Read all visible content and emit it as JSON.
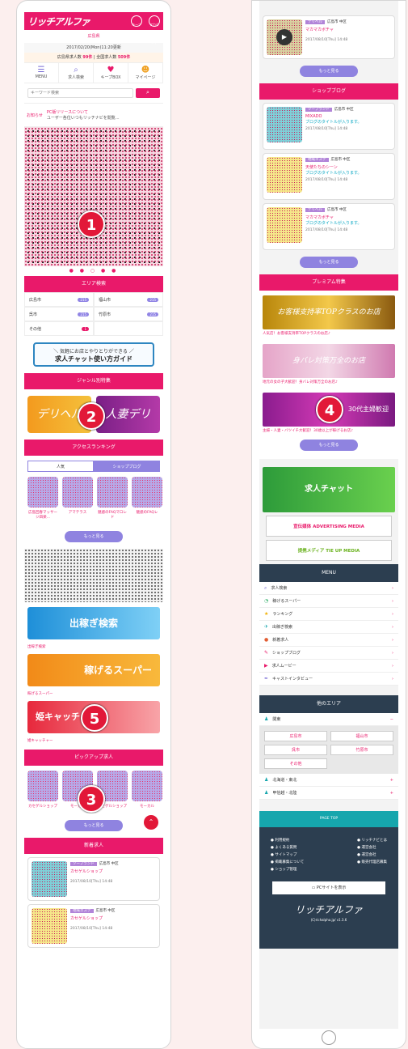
{
  "app": {
    "logo": "リッチアルファ",
    "header_icons": [
      "キープ",
      "アカウント"
    ]
  },
  "location": "広島県",
  "datetime": "2017/02/20(Mon)11:20更新",
  "counts": {
    "jobs_label": "広島県求人数",
    "jobs": "99件",
    "all_label": "全国求人数",
    "all": "509件"
  },
  "nav": [
    {
      "icon": "☰",
      "label": "MENU"
    },
    {
      "icon": "⌕",
      "label": "求人検索"
    },
    {
      "icon": "♥",
      "label": "キープBOX"
    },
    {
      "icon": "☻",
      "label": "マイページ"
    }
  ],
  "search": {
    "placeholder": "キーワード検索",
    "button": "⌕"
  },
  "notice": {
    "tag": "お知らせ",
    "title": "PC版リリースについて",
    "body": "ユーザー各位いつもリッチナビを閲覧..."
  },
  "badges": [
    "1",
    "2",
    "3",
    "4",
    "5"
  ],
  "area_section": {
    "title": "エリア検索",
    "items": [
      {
        "name": "広島市",
        "count": "215"
      },
      {
        "name": "福山市",
        "count": "215"
      },
      {
        "name": "呉市",
        "count": "215"
      },
      {
        "name": "竹原市",
        "count": "215"
      },
      {
        "name": "その他",
        "count": "1"
      }
    ]
  },
  "chat_banner": {
    "sub": "＼ 気軽にお店とやりとりができる ／",
    "main": "求人チャット使い方ガイド"
  },
  "genre_section": {
    "title": "ジャンル別特集",
    "items": [
      "デリヘル",
      "人妻デリ"
    ]
  },
  "ranking": {
    "title": "アクセスランキング",
    "tabs": [
      "人気",
      "ショップブログ"
    ],
    "cards": [
      "広島回春マッサージ四楽...",
      "アマテラス",
      "魅惑のFAQマロレド",
      "魅惑のFAQレ"
    ]
  },
  "more": "もっと見る",
  "ads": [
    {
      "title": "出稼ぎ検索",
      "cap": "出稼ぎ検索"
    },
    {
      "title": "稼げるスーパー",
      "cap": "稼げるスーパー"
    },
    {
      "title": "姫キャッチャー",
      "cap": "姫キャッチャー"
    }
  ],
  "pickup": {
    "title": "ピックアップ求人",
    "cards": [
      "カセゲルショップ",
      "モーカル",
      "カセゲルショップ",
      "モーカル"
    ]
  },
  "new_jobs": {
    "title": "新着求人",
    "items": [
      {
        "tag": "ソープランド",
        "area": "広島市 中区",
        "name": "カセゲルショップ",
        "time": "2017/08/10[Thu] 14:48"
      },
      {
        "tag": "地域エステ",
        "area": "広島市 中区",
        "name": "カセゲルショップ",
        "time": "2017/08/10[Thu] 14:48"
      }
    ]
  },
  "movie_item": {
    "tag": "デリヘル",
    "area": "広島市 中区",
    "name": "マカマカボチャ",
    "time": "2017/08/10[Thu] 14:48"
  },
  "shop_blog": {
    "title": "ショップブログ",
    "items": [
      {
        "tag": "ソープランド",
        "area": "広島市 中区",
        "name": "MIXADO",
        "desc": "ブログのタイトルが入ります。",
        "time": "2017/08/10[Thu] 14:48"
      },
      {
        "tag": "地域エステ",
        "area": "広島市 中区",
        "name": "天使たちのシーン",
        "desc": "ブログのタイトルが入ります。",
        "time": "2017/08/10[Thu] 14:48"
      },
      {
        "tag": "デリヘル",
        "area": "広島市 中区",
        "name": "マカマカボチャ",
        "desc": "ブログのタイトルが入ります。",
        "time": "2017/08/10[Thu] 14:48"
      }
    ]
  },
  "premium": {
    "title": "プレミアム特集",
    "items": [
      {
        "banner": "お客様支持率TOPクラスのお店",
        "cap": "人気店！お客様支持率TOPクラスのお店♪"
      },
      {
        "banner": "身バレ対策万全のお店",
        "cap": "地元の女の子大歓迎！身バレ対策万全のお店♪"
      },
      {
        "banner": "30代主婦歓迎",
        "cap": "主婦・人妻・バツイチ大歓迎！30歳以上が稼げるお店♪"
      }
    ]
  },
  "side_banners": [
    {
      "label": "求人チャット"
    },
    {
      "label": "宣伝媒体 ADVERTISING MEDIA"
    },
    {
      "label": "提携メディア TIE UP MEDIA"
    }
  ],
  "menu": {
    "title": "MENU",
    "items": [
      {
        "icon": "⌕",
        "label": "求人検索"
      },
      {
        "icon": "◔",
        "label": "稼げるスーパー"
      },
      {
        "icon": "★",
        "label": "ランキング"
      },
      {
        "icon": "✈",
        "label": "出稼ぎ検索"
      },
      {
        "icon": "●",
        "label": "新着求人"
      },
      {
        "icon": "✎",
        "label": "ショップブログ"
      },
      {
        "icon": "▶",
        "label": "求人ムービー"
      },
      {
        "icon": "✒",
        "label": "キャストインタビュー"
      }
    ]
  },
  "other_area": {
    "title": "他のエリア",
    "region": "関東",
    "buttons": [
      "広島市",
      "福山市",
      "呉市",
      "竹原市",
      "その他"
    ],
    "regions": [
      "北海道・東北",
      "甲信越・北陸"
    ]
  },
  "footer": {
    "pagetop": "PAGE TOP",
    "left": [
      "利用規約",
      "よくある質問",
      "サイトマップ",
      "掲載募集について",
      "ショップ管理"
    ],
    "right": [
      "リッチナビとは",
      "運営会社",
      "運営会社",
      "販売代理店募集"
    ],
    "pc": "PCサイトを表示",
    "logo": "リッチアルファ",
    "copy": "(C)richalpha.jp/ v1.3.6"
  },
  "colors": {
    "accent": "#e9196a",
    "purple": "#8f83e0",
    "navy": "#2c3e50"
  }
}
